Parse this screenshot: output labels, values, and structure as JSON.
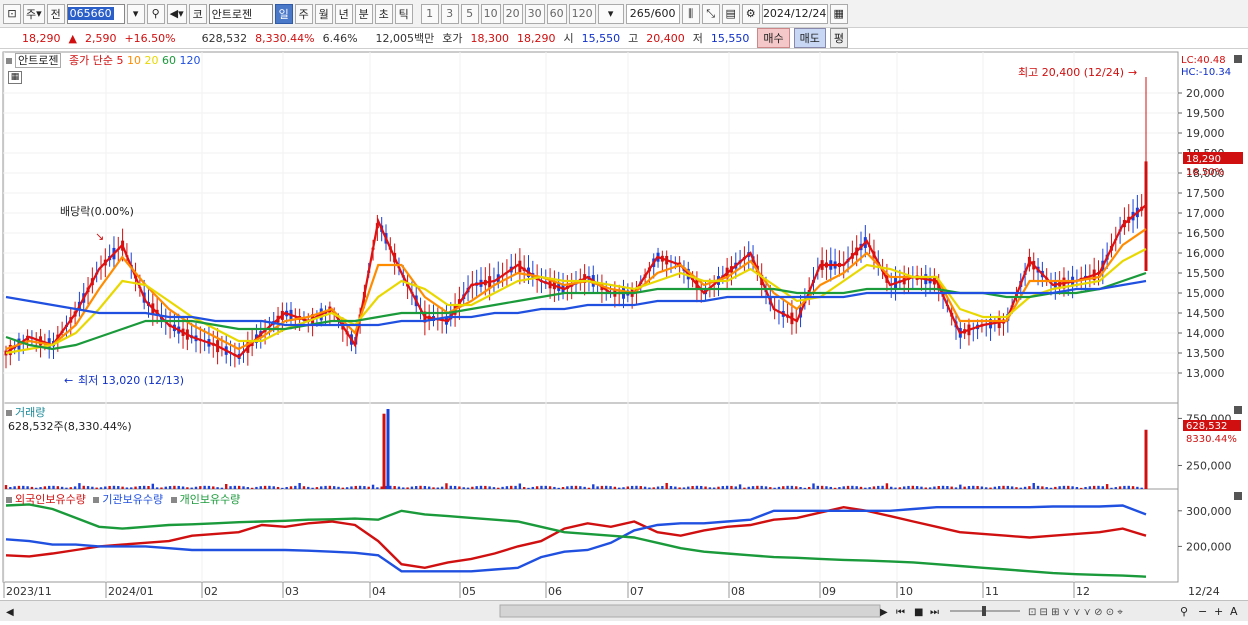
{
  "toolbar": {
    "type_label": "주",
    "mode_label": "전",
    "code": "065660",
    "name": "안트로젠",
    "name_prefix": "코",
    "periods": [
      "일",
      "주",
      "월",
      "년",
      "분",
      "초",
      "틱"
    ],
    "active_period": "일",
    "intervals": [
      "1",
      "3",
      "5",
      "10",
      "20",
      "30",
      "60",
      "120"
    ],
    "count": "265",
    "count_max": "/600",
    "date": "2024/12/24"
  },
  "pricebar": {
    "price": "18,290",
    "change": "2,590",
    "change_pct": "+16.50%",
    "volume": "628,532",
    "volume_pct": "8,330.44%",
    "turnover_pct": "6.46%",
    "amount": "12,005백만",
    "bid_label": "호가",
    "bid": "18,300",
    "ask": "18,290",
    "open_label": "시",
    "open": "15,550",
    "high_label": "고",
    "high": "20,400",
    "low_label": "저",
    "low": "15,550",
    "buy": "매수",
    "sell": "매도",
    "eval": "평"
  },
  "price_panel": {
    "name": "안트로젠",
    "legend_label": "종가 단순",
    "ma_periods": [
      "5",
      "10",
      "20",
      "60",
      "120"
    ],
    "ma_colors": [
      "#e01010",
      "#ff8c00",
      "#e8d800",
      "#1a9a3a",
      "#2050e0"
    ],
    "high_annotation": "최고 20,400 (12/24)",
    "low_annotation": "최저 13,020 (12/13)",
    "dividend_annotation": "배당락(0.00%)",
    "lc": "LC:40.48",
    "hc": "HC:-10.34",
    "current_price_tag": "18,290",
    "current_pct_tag": "16.50%"
  },
  "volume_panel": {
    "title": "거래량",
    "summary": "628,532주(8,330.44%)",
    "current_tag": "628,532",
    "pct_tag": "8330.44%"
  },
  "holding_panel": {
    "foreign": "외국인보유수량",
    "institution": "기관보유수량",
    "individual": "개인보유수량"
  },
  "x_axis": [
    "2023/11",
    "2024/01",
    "02",
    "03",
    "04",
    "05",
    "06",
    "07",
    "08",
    "09",
    "10",
    "11",
    "12",
    "12/24"
  ],
  "chart_data": [
    {
      "type": "line",
      "title": "",
      "ylim": [
        12700,
        20600
      ],
      "y_ticks": [
        "20,000",
        "19,500",
        "19,000",
        "18,500",
        "18,000",
        "17,500",
        "17,000",
        "16,500",
        "16,000",
        "15,500",
        "15,000",
        "14,500",
        "14,000",
        "13,500",
        "13,000"
      ],
      "series": [
        {
          "name": "5",
          "values": [
            13500,
            13900,
            13700,
            14500,
            15600,
            16200,
            14800,
            14200,
            13900,
            13700,
            13400,
            14000,
            14500,
            14300,
            14600,
            13700,
            16800,
            15500,
            14400,
            14300,
            15200,
            15300,
            15700,
            15300,
            15100,
            15400,
            15000,
            15000,
            15900,
            15700,
            15000,
            15500,
            16000,
            14600,
            14300,
            15700,
            15700,
            16300,
            15200,
            15400,
            15300,
            14000,
            14200,
            14300,
            15800,
            15200,
            15300,
            15500,
            16700,
            17200
          ]
        },
        {
          "name": "10",
          "values": [
            13600,
            13800,
            13700,
            14200,
            15100,
            15900,
            15200,
            14600,
            14200,
            13900,
            13600,
            13900,
            14300,
            14400,
            14600,
            14000,
            15700,
            15700,
            14900,
            14500,
            14800,
            15200,
            15500,
            15400,
            15200,
            15300,
            15100,
            15000,
            15500,
            15700,
            15200,
            15400,
            15800,
            15000,
            14600,
            15200,
            15500,
            16000,
            15400,
            15400,
            15400,
            14300,
            14300,
            14300,
            15300,
            15300,
            15300,
            15400,
            16200,
            16600
          ]
        },
        {
          "name": "20",
          "values": [
            13500,
            13600,
            13700,
            14000,
            14600,
            15300,
            15200,
            14800,
            14400,
            14100,
            13800,
            13800,
            14100,
            14300,
            14500,
            14200,
            14900,
            15300,
            15100,
            14700,
            14700,
            15000,
            15300,
            15400,
            15300,
            15300,
            15200,
            15100,
            15300,
            15500,
            15300,
            15300,
            15600,
            15200,
            14800,
            14900,
            15300,
            15700,
            15600,
            15400,
            15400,
            14600,
            14400,
            14400,
            14900,
            15100,
            15200,
            15300,
            15800,
            16100
          ]
        },
        {
          "name": "60",
          "values": [
            13900,
            13700,
            13600,
            13700,
            13900,
            14100,
            14300,
            14300,
            14300,
            14200,
            14100,
            14100,
            14100,
            14200,
            14300,
            14300,
            14400,
            14500,
            14500,
            14500,
            14600,
            14700,
            14800,
            14900,
            15000,
            15000,
            15000,
            15000,
            15100,
            15100,
            15100,
            15100,
            15100,
            15100,
            15000,
            15000,
            15000,
            15100,
            15100,
            15100,
            15100,
            15000,
            15000,
            14900,
            14900,
            15000,
            15000,
            15100,
            15300,
            15500
          ]
        },
        {
          "name": "120",
          "values": [
            14900,
            14800,
            14700,
            14600,
            14500,
            14500,
            14500,
            14400,
            14400,
            14300,
            14300,
            14300,
            14200,
            14200,
            14200,
            14200,
            14200,
            14300,
            14300,
            14400,
            14400,
            14500,
            14500,
            14600,
            14600,
            14700,
            14700,
            14700,
            14800,
            14800,
            14800,
            14900,
            14900,
            14900,
            14900,
            14900,
            14900,
            15000,
            15000,
            15000,
            15000,
            15000,
            15000,
            15000,
            15000,
            15000,
            15100,
            15100,
            15200,
            15300
          ]
        }
      ]
    },
    {
      "type": "bar",
      "title": "",
      "ylim": [
        0,
        850000
      ],
      "y_ticks": [
        "750,000",
        "250,000"
      ],
      "spikes": [
        {
          "x": "04",
          "value": 880000
        },
        {
          "x": "12/24",
          "value": 628532
        }
      ]
    },
    {
      "type": "line",
      "title": "",
      "ylim": [
        100000,
        350000
      ],
      "y_ticks": [
        "300,000",
        "200,000"
      ],
      "series": [
        {
          "name": "외국인보유수량",
          "values": [
            175000,
            172000,
            180000,
            190000,
            200000,
            205000,
            210000,
            215000,
            230000,
            235000,
            240000,
            260000,
            255000,
            265000,
            270000,
            260000,
            215000,
            150000,
            140000,
            155000,
            165000,
            180000,
            200000,
            215000,
            250000,
            265000,
            255000,
            270000,
            240000,
            230000,
            245000,
            255000,
            260000,
            275000,
            280000,
            295000,
            310000,
            300000,
            285000,
            270000,
            255000,
            240000,
            235000,
            230000,
            225000,
            230000,
            235000,
            240000,
            250000,
            230000
          ]
        },
        {
          "name": "기관보유수량",
          "values": [
            220000,
            215000,
            205000,
            205000,
            200000,
            200000,
            200000,
            195000,
            190000,
            190000,
            190000,
            190000,
            190000,
            188000,
            185000,
            182000,
            175000,
            130000,
            130000,
            130000,
            130000,
            135000,
            140000,
            170000,
            185000,
            190000,
            210000,
            245000,
            260000,
            265000,
            265000,
            270000,
            275000,
            300000,
            300000,
            300000,
            300000,
            300000,
            300000,
            305000,
            310000,
            310000,
            310000,
            310000,
            310000,
            312000,
            312000,
            312000,
            315000,
            290000
          ]
        },
        {
          "name": "개인보유수량",
          "values": [
            315000,
            318000,
            305000,
            280000,
            255000,
            250000,
            255000,
            260000,
            262000,
            265000,
            268000,
            270000,
            272000,
            275000,
            276000,
            278000,
            275000,
            300000,
            290000,
            285000,
            280000,
            275000,
            270000,
            255000,
            240000,
            235000,
            230000,
            225000,
            210000,
            195000,
            185000,
            180000,
            175000,
            170000,
            168000,
            165000,
            162000,
            160000,
            158000,
            155000,
            150000,
            145000,
            140000,
            135000,
            130000,
            125000,
            122000,
            120000,
            118000,
            115000
          ]
        }
      ]
    }
  ]
}
